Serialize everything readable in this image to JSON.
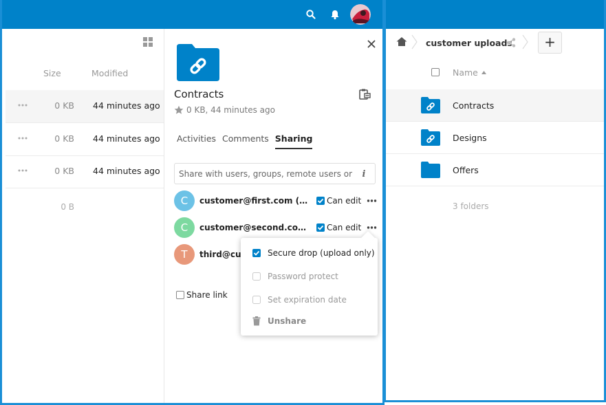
{
  "left_files": {
    "headers": {
      "size": "Size",
      "modified": "Modified"
    },
    "rows": [
      {
        "size": "0 KB",
        "modified": "44 minutes ago"
      },
      {
        "size": "0 KB",
        "modified": "44 minutes ago"
      },
      {
        "size": "0 KB",
        "modified": "44 minutes ago"
      }
    ],
    "total_size": "0 B"
  },
  "sidebar": {
    "title": "Contracts",
    "meta": "0 KB, 44 minutes ago",
    "tabs": [
      {
        "label": "Activities"
      },
      {
        "label": "Comments"
      },
      {
        "label": "Sharing"
      }
    ],
    "share_placeholder": "Share with users, groups, remote users or by…",
    "sharees": [
      {
        "initial": "C",
        "name": "customer@first.com (em…",
        "permission": "Can edit",
        "color": "#6cc2e6"
      },
      {
        "initial": "C",
        "name": "customer@second.com (e…",
        "permission": "Can edit",
        "color": "#7dd9a0"
      },
      {
        "initial": "T",
        "name": "third@cust",
        "color": "#e8987a"
      }
    ],
    "share_link_label": "Share link"
  },
  "popover": {
    "items": [
      {
        "label": "Secure drop (upload only)",
        "checked": true
      },
      {
        "label": "Password protect",
        "checked": false
      },
      {
        "label": "Set expiration date",
        "checked": false
      },
      {
        "label": "Unshare"
      }
    ]
  },
  "right_files": {
    "breadcrumb": "customer uploads",
    "add_label": "+",
    "header_name": "Name",
    "rows": [
      {
        "name": "Contracts",
        "icon": "shared-folder-icon"
      },
      {
        "name": "Designs",
        "icon": "shared-folder-icon"
      },
      {
        "name": "Offers",
        "icon": "folder-icon"
      }
    ],
    "summary": "3 folders"
  },
  "colors": {
    "brand": "#0082c9",
    "accent_check": "#0082c9",
    "window_border": "#1a8fd6"
  }
}
